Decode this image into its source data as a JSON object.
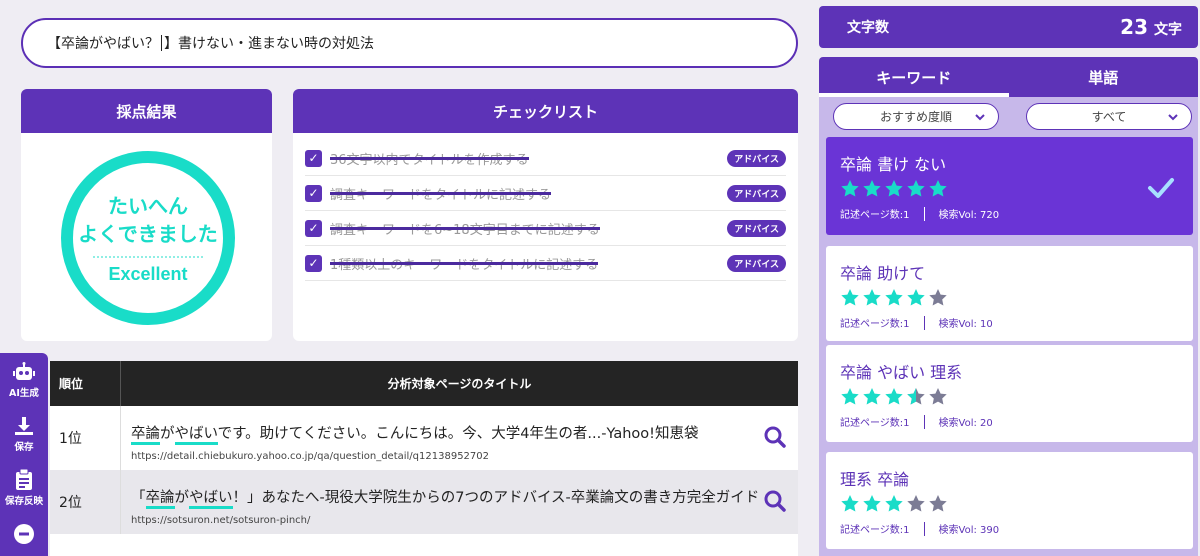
{
  "title_input": {
    "before_caret": "【卒論がやばい？",
    "after_caret": "】書けない・進まない時の対処法"
  },
  "score": {
    "header": "採点結果",
    "line1": "たいへん",
    "line2": "よくできました",
    "line3": "Excellent",
    "color": "#19dcc8"
  },
  "checklist": {
    "header": "チェックリスト",
    "advice_label": "アドバイス",
    "items": [
      {
        "text": "36文字以内でタイトルを作成する",
        "checked": true
      },
      {
        "text": "調査キーワードをタイトルに記述する",
        "checked": true
      },
      {
        "text": "調査キーワードを6~18文字目までに記述する",
        "checked": true
      },
      {
        "text": "1種類以上のキーワードをタイトルに記述する",
        "checked": true
      }
    ]
  },
  "table": {
    "col_rank": "順位",
    "col_title": "分析対象ページのタイトル",
    "rows": [
      {
        "rank": "1位",
        "title_parts": [
          "",
          "卒論",
          "が",
          "やばい",
          "です。助けてください。こんにちは。今、大学4年生の者...-Yahoo!知恵袋"
        ],
        "url": "https://detail.chiebukuro.yahoo.co.jp/qa/question_detail/q12138952702"
      },
      {
        "rank": "2位",
        "title_parts": [
          "「",
          "卒論",
          "が",
          "やばい",
          "！」あなたへ-現役大学院生からの7つのアドバイス-卒業論文の書き方完全ガイド"
        ],
        "url": "https://sotsuron.net/sotsuron-pinch/"
      }
    ]
  },
  "side_tools": [
    {
      "label": "AI生成",
      "icon": "robot-icon"
    },
    {
      "label": "保存",
      "icon": "download-icon"
    },
    {
      "label": "保存反映",
      "icon": "clipboard-icon"
    },
    {
      "label": "",
      "icon": "minus-circle-icon"
    }
  ],
  "char_count": {
    "label": "文字数",
    "value": "23",
    "unit": "文字"
  },
  "right_tabs": [
    {
      "label": "キーワード",
      "active": true
    },
    {
      "label": "単語",
      "active": false
    }
  ],
  "filters": {
    "sort": "おすすめ度順",
    "type": "すべて"
  },
  "keywords": [
    {
      "keyword": "卒論 書け ない",
      "stars": 5,
      "pages_label": "記述ページ数:1",
      "vol_label": "検索Vol: 720",
      "selected": true
    },
    {
      "keyword": "卒論 助けて",
      "stars": 4,
      "pages_label": "記述ページ数:1",
      "vol_label": "検索Vol: 10",
      "selected": false
    },
    {
      "keyword": "卒論 やばい 理系",
      "stars": 3.5,
      "pages_label": "記述ページ数:1",
      "vol_label": "検索Vol: 20",
      "selected": false
    },
    {
      "keyword": "理系 卒論",
      "stars": 3,
      "pages_label": "記述ページ数:1",
      "vol_label": "検索Vol: 390",
      "selected": false
    }
  ],
  "colors": {
    "primary": "#5d33b7",
    "accent": "#19dcc8",
    "star_off": "#7c7c95"
  }
}
